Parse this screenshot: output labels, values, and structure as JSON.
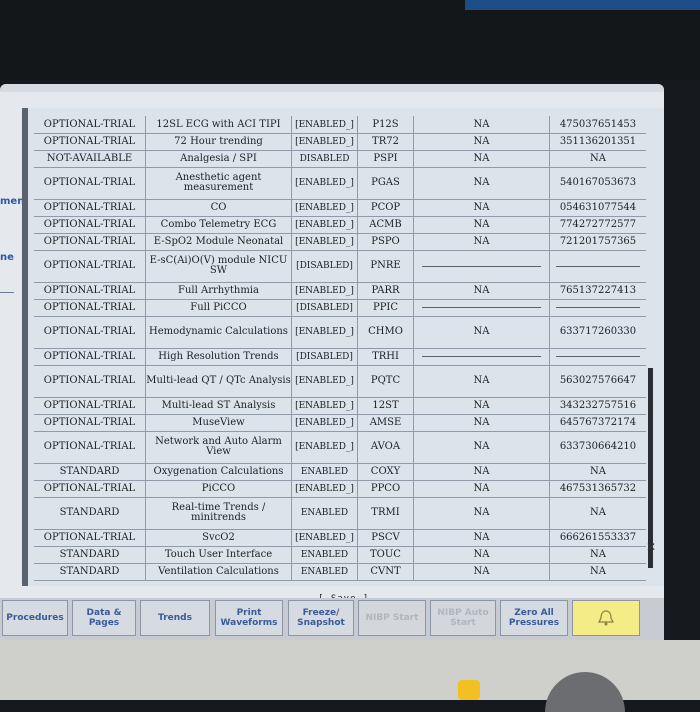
{
  "side_labels": [
    "ment",
    "ne"
  ],
  "features": [
    {
      "license": "OPTIONAL-TRIAL",
      "name": "12SL ECG with ACI TIPI",
      "status": "[ENABLED_]",
      "code": "P12S",
      "na": "NA",
      "key": "475037651453"
    },
    {
      "license": "OPTIONAL-TRIAL",
      "name": "72 Hour trending",
      "status": "[ENABLED_]",
      "code": "TR72",
      "na": "NA",
      "key": "351136201351"
    },
    {
      "license": "NOT-AVAILABLE",
      "name": "Analgesia / SPI",
      "status": "DISABLED",
      "code": "PSPI",
      "na": "NA",
      "key": "NA"
    },
    {
      "license": "OPTIONAL-TRIAL",
      "name": "Anesthetic agent measurement",
      "status": "[ENABLED_]",
      "code": "PGAS",
      "na": "NA",
      "key": "540167053673"
    },
    {
      "license": "OPTIONAL-TRIAL",
      "name": "CO",
      "status": "[ENABLED_]",
      "code": "PCOP",
      "na": "NA",
      "key": "054631077544"
    },
    {
      "license": "OPTIONAL-TRIAL",
      "name": "Combo Telemetry ECG",
      "status": "[ENABLED_]",
      "code": "ACMB",
      "na": "NA",
      "key": "774272772577"
    },
    {
      "license": "OPTIONAL-TRIAL",
      "name": "E-SpO2 Module Neonatal",
      "status": "[ENABLED_]",
      "code": "PSPO",
      "na": "NA",
      "key": "721201757365"
    },
    {
      "license": "OPTIONAL-TRIAL",
      "name": "E-sC(Ai)O(V) module NICU SW",
      "status": "[DISABLED]",
      "code": "PNRE",
      "na": "",
      "key": ""
    },
    {
      "license": "OPTIONAL-TRIAL",
      "name": "Full Arrhythmia",
      "status": "[ENABLED_]",
      "code": "PARR",
      "na": "NA",
      "key": "765137227413"
    },
    {
      "license": "OPTIONAL-TRIAL",
      "name": "Full PiCCO",
      "status": "[DISABLED]",
      "code": "PPIC",
      "na": "",
      "key": ""
    },
    {
      "license": "OPTIONAL-TRIAL",
      "name": "Hemodynamic Calculations",
      "status": "[ENABLED_]",
      "code": "CHMO",
      "na": "NA",
      "key": "633717260330"
    },
    {
      "license": "OPTIONAL-TRIAL",
      "name": "High Resolution Trends",
      "status": "[DISABLED]",
      "code": "TRHI",
      "na": "",
      "key": ""
    },
    {
      "license": "OPTIONAL-TRIAL",
      "name": "Multi-lead QT / QTc Analysis",
      "status": "[ENABLED_]",
      "code": "PQTC",
      "na": "NA",
      "key": "563027576647"
    },
    {
      "license": "OPTIONAL-TRIAL",
      "name": "Multi-lead ST Analysis",
      "status": "[ENABLED_]",
      "code": "12ST",
      "na": "NA",
      "key": "343232757516"
    },
    {
      "license": "OPTIONAL-TRIAL",
      "name": "MuseView",
      "status": "[ENABLED_]",
      "code": "AMSE",
      "na": "NA",
      "key": "645767372174"
    },
    {
      "license": "OPTIONAL-TRIAL",
      "name": "Network and Auto Alarm View",
      "status": "[ENABLED_]",
      "code": "AVOA",
      "na": "NA",
      "key": "633730664210"
    },
    {
      "license": "STANDARD",
      "name": "Oxygenation Calculations",
      "status": "ENABLED",
      "code": "COXY",
      "na": "NA",
      "key": "NA"
    },
    {
      "license": "OPTIONAL-TRIAL",
      "name": "PiCCO",
      "status": "[ENABLED_]",
      "code": "PPCO",
      "na": "NA",
      "key": "467531365732"
    },
    {
      "license": "STANDARD",
      "name": "Real-time Trends / minitrends",
      "status": "ENABLED",
      "code": "TRMI",
      "na": "NA",
      "key": "NA"
    },
    {
      "license": "OPTIONAL-TRIAL",
      "name": "SvcO2",
      "status": "[ENABLED_]",
      "code": "PSCV",
      "na": "NA",
      "key": "666261553337"
    },
    {
      "license": "STANDARD",
      "name": "Touch User Interface",
      "status": "ENABLED",
      "code": "TOUC",
      "na": "NA",
      "key": "NA"
    },
    {
      "license": "STANDARD",
      "name": "Ventilation Calculations",
      "status": "ENABLED",
      "code": "CVNT",
      "na": "NA",
      "key": "NA"
    }
  ],
  "save_label": "[ Save ]",
  "toolbar": {
    "buttons": [
      {
        "label": "Procedures",
        "disabled": false
      },
      {
        "label": "Data & Pages",
        "disabled": false
      },
      {
        "label": "Trends",
        "disabled": false
      },
      {
        "label": "Print Waveforms",
        "disabled": false
      },
      {
        "label": "Freeze/ Snapshot",
        "disabled": false
      },
      {
        "label": "NIBP Start",
        "disabled": true
      },
      {
        "label": "NIBP Auto Start",
        "disabled": true
      },
      {
        "label": "Zero All Pressures",
        "disabled": false
      }
    ],
    "alarm_icon": "bell-alarm-icon"
  },
  "colors": {
    "screen_bg": "#e5e8ec",
    "button_text": "#3a5a9a",
    "alarm_button": "#f4ec86"
  }
}
